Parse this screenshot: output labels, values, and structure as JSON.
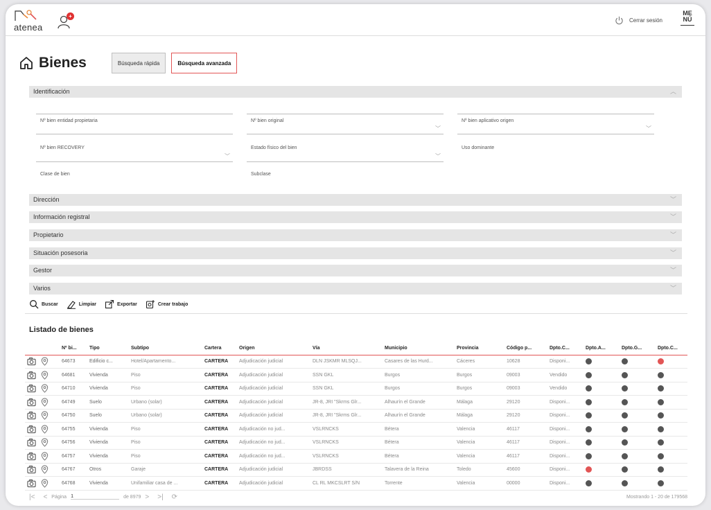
{
  "app": {
    "logo_text": "atenea",
    "notifications": "+"
  },
  "header": {
    "logout_label": "Cerrar sesión",
    "menu_top": "ME",
    "menu_bottom": "NÚ"
  },
  "page": {
    "title": "Bienes",
    "tabs": [
      {
        "label": "Búsqueda rápida",
        "active": false
      },
      {
        "label": "Búsqueda avanzada",
        "active": true
      }
    ]
  },
  "identificacion": {
    "title": "Identificación",
    "fields": [
      {
        "label": "Nº bien entidad propietaria",
        "dropdown": false
      },
      {
        "label": "Nº bien original",
        "dropdown": true
      },
      {
        "label": "Nº bien aplicativo origen",
        "dropdown": true
      },
      {
        "label": "Nº bien RECOVERY",
        "dropdown": true
      },
      {
        "label": "Estado físico del bien",
        "dropdown": true
      },
      {
        "label": "Uso dominante",
        "dropdown": false
      },
      {
        "label": "Clase de bien",
        "dropdown": false
      },
      {
        "label": "Subclase",
        "dropdown": false
      }
    ]
  },
  "sections": [
    "Dirección",
    "Información registral",
    "Propietario",
    "Situación posesoria",
    "Gestor",
    "Varios"
  ],
  "actions": {
    "search": "Buscar",
    "clear": "Limpiar",
    "export": "Exportar",
    "create": "Crear trabajo"
  },
  "listing": {
    "title": "Listado de bienes",
    "columns": [
      "Nº bi...",
      "Tipo",
      "Subtipo",
      "Cartera",
      "Origen",
      "Vía",
      "Municipio",
      "Provincia",
      "Código p...",
      "Dpto.C...",
      "Dpto.A...",
      "Dpto.G...",
      "Dpto.C..."
    ],
    "rows": [
      {
        "num": "64673",
        "tipo": "Edificio c...",
        "subtipo": "Hotel/Apartamento...",
        "cartera": "CARTERA",
        "origen": "Adjudicación judicial",
        "via": "DLN JSKMR MLSQJ...",
        "municipio": "Casares de las Hurd...",
        "provincia": "Cáceres",
        "cp": "10628",
        "estado": "Disponi...",
        "d1": "grey",
        "d2": "grey",
        "d3": "red"
      },
      {
        "num": "64681",
        "tipo": "Vivienda",
        "subtipo": "Piso",
        "cartera": "CARTERA",
        "origen": "Adjudicación judicial",
        "via": "SSN GKL",
        "municipio": "Burgos",
        "provincia": "Burgos",
        "cp": "09003",
        "estado": "Vendido",
        "d1": "grey",
        "d2": "grey",
        "d3": "grey"
      },
      {
        "num": "64710",
        "tipo": "Vivienda",
        "subtipo": "Piso",
        "cartera": "CARTERA",
        "origen": "Adjudicación judicial",
        "via": "SSN GKL",
        "municipio": "Burgos",
        "provincia": "Burgos",
        "cp": "09003",
        "estado": "Vendido",
        "d1": "grey",
        "d2": "grey",
        "d3": "grey"
      },
      {
        "num": "64749",
        "tipo": "Suelo",
        "subtipo": "Urbano (solar)",
        "cartera": "CARTERA",
        "origen": "Adjudicación judicial",
        "via": "JR-8, JRI \"Skrms Glr...",
        "municipio": "Alhaurín el Grande",
        "provincia": "Málaga",
        "cp": "29120",
        "estado": "Disponi...",
        "d1": "grey",
        "d2": "grey",
        "d3": "grey"
      },
      {
        "num": "64750",
        "tipo": "Suelo",
        "subtipo": "Urbano (solar)",
        "cartera": "CARTERA",
        "origen": "Adjudicación judicial",
        "via": "JR-8, JRI \"Skrms Glr...",
        "municipio": "Alhaurín el Grande",
        "provincia": "Málaga",
        "cp": "29120",
        "estado": "Disponi...",
        "d1": "grey",
        "d2": "grey",
        "d3": "grey"
      },
      {
        "num": "64755",
        "tipo": "Vivienda",
        "subtipo": "Piso",
        "cartera": "CARTERA",
        "origen": "Adjudicación no jud...",
        "via": "VSLRNCKS",
        "municipio": "Bétera",
        "provincia": "Valencia",
        "cp": "46117",
        "estado": "Disponi...",
        "d1": "grey",
        "d2": "grey",
        "d3": "grey"
      },
      {
        "num": "64756",
        "tipo": "Vivienda",
        "subtipo": "Piso",
        "cartera": "CARTERA",
        "origen": "Adjudicación no jud...",
        "via": "VSLRNCKS",
        "municipio": "Bétera",
        "provincia": "Valencia",
        "cp": "46117",
        "estado": "Disponi...",
        "d1": "grey",
        "d2": "grey",
        "d3": "grey"
      },
      {
        "num": "64757",
        "tipo": "Vivienda",
        "subtipo": "Piso",
        "cartera": "CARTERA",
        "origen": "Adjudicación no jud...",
        "via": "VSLRNCKS",
        "municipio": "Bétera",
        "provincia": "Valencia",
        "cp": "46117",
        "estado": "Disponi...",
        "d1": "grey",
        "d2": "grey",
        "d3": "grey"
      },
      {
        "num": "64767",
        "tipo": "Otros",
        "subtipo": "Garaje",
        "cartera": "CARTERA",
        "origen": "Adjudicación judicial",
        "via": "JBRDSS",
        "municipio": "Talavera de la Reina",
        "provincia": "Toledo",
        "cp": "45600",
        "estado": "Disponi...",
        "d1": "red",
        "d2": "grey",
        "d3": "grey"
      },
      {
        "num": "64768",
        "tipo": "Vivienda",
        "subtipo": "Unifamiliar casa de ...",
        "cartera": "CARTERA",
        "origen": "Adjudicación judicial",
        "via": "CL RL MKCSLRT S/N",
        "municipio": "Torrente",
        "provincia": "Valencia",
        "cp": "00000",
        "estado": "Disponi...",
        "d1": "grey",
        "d2": "grey",
        "d3": "grey"
      }
    ]
  },
  "pagination": {
    "page_label": "Página",
    "page": "1",
    "of_label": "de 8979",
    "showing": "Mostrando 1 - 20 de 179568"
  },
  "colors": {
    "accent": "#e25555",
    "dot_grey": "#555555",
    "section_bg": "#e5e5e5"
  }
}
